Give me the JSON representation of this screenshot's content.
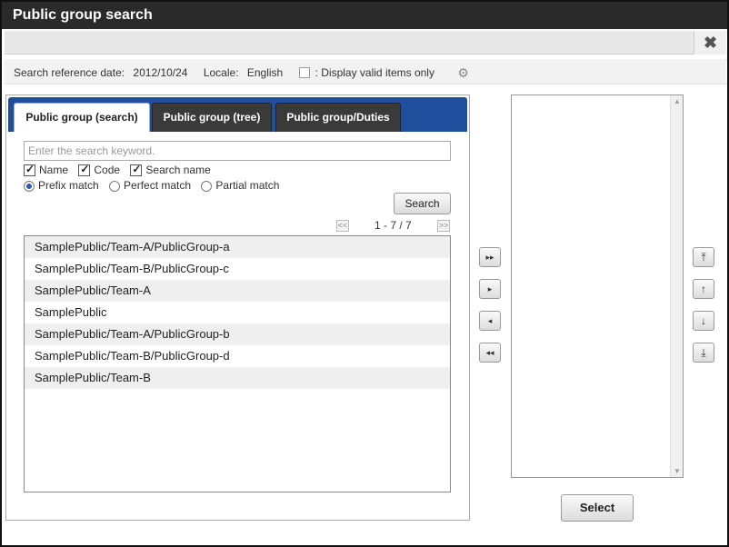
{
  "window": {
    "title": "Public group search"
  },
  "info": {
    "ref_date_label": "Search reference date:",
    "ref_date_value": "2012/10/24",
    "locale_label": "Locale:",
    "locale_value": "English",
    "valid_only_label": ": Display valid items only",
    "valid_only_checked": false
  },
  "tabs": [
    {
      "label": "Public group (search)",
      "active": true
    },
    {
      "label": "Public group (tree)",
      "active": false
    },
    {
      "label": "Public group/Duties",
      "active": false
    }
  ],
  "search": {
    "placeholder": "Enter the search keyword.",
    "value": "",
    "button_label": "Search",
    "checks": [
      {
        "label": "Name",
        "checked": true
      },
      {
        "label": "Code",
        "checked": true
      },
      {
        "label": "Search name",
        "checked": true
      }
    ],
    "match_modes": [
      {
        "label": "Prefix match",
        "selected": true
      },
      {
        "label": "Perfect match",
        "selected": false
      },
      {
        "label": "Partial match",
        "selected": false
      }
    ]
  },
  "pager": {
    "text": "1 - 7 / 7",
    "prev": "<<",
    "next": ">>"
  },
  "results": [
    "SamplePublic/Team-A/PublicGroup-a",
    "SamplePublic/Team-B/PublicGroup-c",
    "SamplePublic/Team-A",
    "SamplePublic",
    "SamplePublic/Team-A/PublicGroup-b",
    "SamplePublic/Team-B/PublicGroup-d",
    "SamplePublic/Team-B"
  ],
  "transfer_icons": {
    "add_all": "▸▸",
    "add": "▸",
    "remove": "◂",
    "remove_all": "◂◂"
  },
  "order_icons": {
    "top": "⤒",
    "up": "↑",
    "down": "↓",
    "bottom": "⤓"
  },
  "selected_items": [],
  "select_button_label": "Select"
}
